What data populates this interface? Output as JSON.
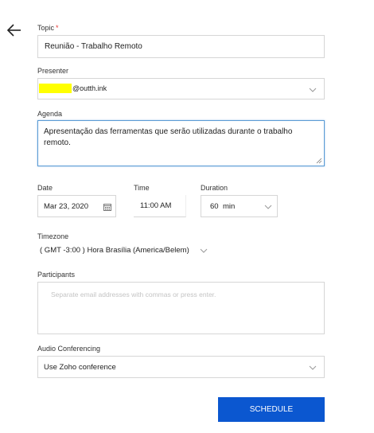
{
  "topic": {
    "label": "Topic",
    "required_mark": "*",
    "value": "Reunião - Trabalho Remoto"
  },
  "presenter": {
    "label": "Presenter",
    "value_suffix": "@outth.ink",
    "redaction_color": "#ffff00"
  },
  "agenda": {
    "label": "Agenda",
    "value": "Apresentação das ferramentas que serão utilizadas durante o trabalho remoto."
  },
  "date": {
    "label": "Date",
    "value": "Mar 23, 2020"
  },
  "time": {
    "label": "Time",
    "value": "11:00 AM"
  },
  "duration": {
    "label": "Duration",
    "value": "60",
    "unit": "min"
  },
  "timezone": {
    "label": "Timezone",
    "value": "( GMT -3:00 ) Hora Brasília (America/Belem)"
  },
  "participants": {
    "label": "Participants",
    "placeholder": "Separate email addresses with commas or press enter."
  },
  "audio": {
    "label": "Audio Conferencing",
    "value": "Use Zoho conference"
  },
  "schedule_button": {
    "label": "SCHEDULE",
    "color": "#0b57d0"
  },
  "colors": {
    "focus_border": "#5b9bd5",
    "border": "#d6d6d6"
  }
}
